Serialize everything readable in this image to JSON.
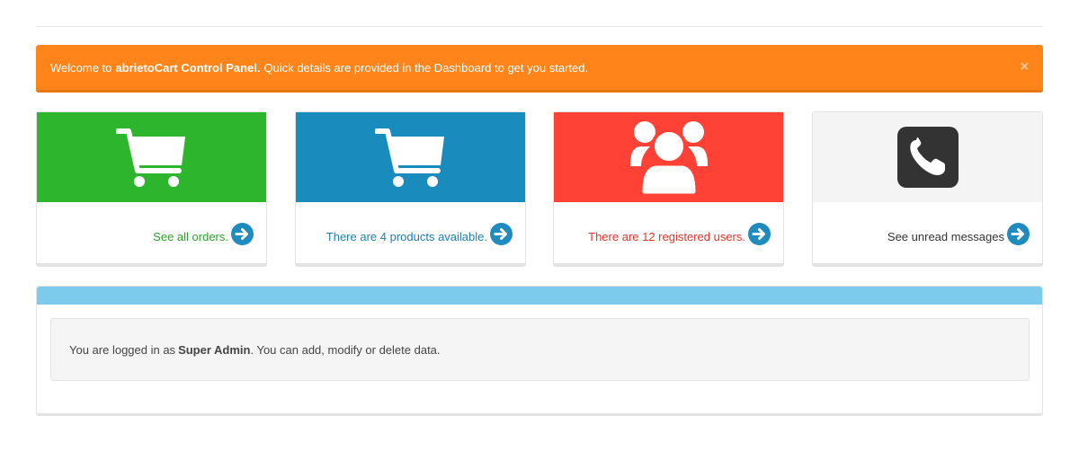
{
  "alert": {
    "prefix": "Welcome to",
    "brand": "abrietoCart Control Panel.",
    "message": "Quick details are provided in the Dashboard to get you started.",
    "close": "×"
  },
  "cards": [
    {
      "text": "See all orders.",
      "icon": "shopping-cart-icon",
      "head_color": "#2db52d",
      "text_color": "#2aa52a"
    },
    {
      "text": "There are 4 products available.",
      "icon": "shopping-cart-icon",
      "head_color": "#1a8bbd",
      "text_color": "#1f7fb0"
    },
    {
      "text": "There are 12 registered users.",
      "icon": "users-icon",
      "head_color": "#ff4136",
      "text_color": "#e8342b"
    },
    {
      "text": "See unread messages",
      "icon": "phone-icon",
      "head_color": "#f4f4f4",
      "text_color": "#333333"
    }
  ],
  "panel": {
    "prefix": "You are logged in as",
    "role": "Super Admin",
    "suffix": ". You can add, modify or delete data."
  }
}
